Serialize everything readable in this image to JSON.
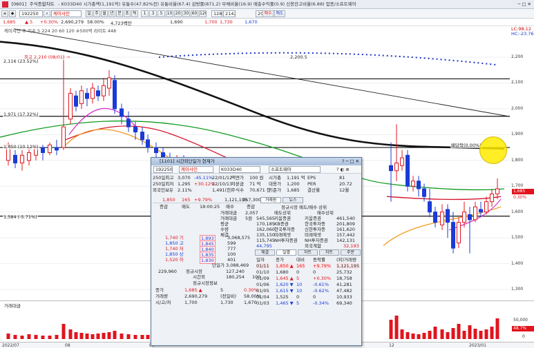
{
  "window_title": {
    "code": "[0601]",
    "name": "주식종합차트",
    "summary": "- K033D40 시가총액(1,191억) 유통수(47.82%전) 유통비율(67.4) 감방률(871.2) 부채비율(16.9) 매출수익률(0.9) 신용잔고비율(6.88) 업종/소프트웨어"
  },
  "toolbar": {
    "code": "192250",
    "name": "케이사인",
    "mode_buttons": [
      "일",
      "주",
      "월",
      "년",
      "분",
      "초",
      "틱"
    ],
    "period_buttons": [
      "1",
      "3",
      "5",
      "10",
      "20",
      "30",
      "60",
      "120"
    ],
    "count": "128",
    "total": "2142",
    "date": "2023/01/11",
    "buy_label": "매수",
    "sell_label": "매도"
  },
  "infobar": {
    "price": "1,685",
    "change": "▲ 5",
    "rate": "+0.30%",
    "volume": "2,690,279",
    "vol_rate": "58.00%",
    "amount": "4,723백만",
    "open": "1,690",
    "high": "1,700",
    "low": "1,730",
    "close": "1,670",
    "text": "1,685 ▲ 5 +0.30% 2,690,279 58.00% 4,723백만 회주전 1,690 1,685 시 1,700 고 1,730 저 1,670"
  },
  "chart": {
    "legend": "케이사인 주 지수 5 224 20 60 120 ※500억 라이트 448",
    "right_top_a": "LC:98.12",
    "right_top_b": "HC:-23.76",
    "high_label": "최고 2,210 (08/01) →",
    "hlines": [
      {
        "label": "2,116 (23.52%)"
      },
      {
        "label": "1,971 (17.32%)"
      },
      {
        "label": "1,850 (10.12%)"
      },
      {
        "label": "1,584 (-5.71%)"
      }
    ],
    "trend_label": "2,200.5",
    "ma_label": "배당락(0.00%)",
    "price_tag": "1,685",
    "price_tag_b": "0.30%",
    "y_ticks": [
      "2,200",
      "2,100",
      "2,000",
      "1,900",
      "1,800",
      "1,700",
      "1,600",
      "1,500",
      "1,400",
      "1,300"
    ],
    "volume_title": "거래대금",
    "volume_ticks": [
      "50,000",
      "0"
    ],
    "volume_tag": "48.7%",
    "x_ticks": [
      "2022/07",
      "08",
      "09",
      "12",
      "2023/01"
    ]
  },
  "popup": {
    "title": "[1101] 시간외단일가 현재가",
    "code": "192250",
    "name": "케이사인",
    "market": "K033D40",
    "sector": "소프트웨어",
    "info_rows": [
      [
        "250일최고",
        "3,070",
        "-45.11%",
        "22/01/12",
        "액면가",
        "100 원",
        "시가총",
        "1,191 억",
        "EPS",
        "81"
      ],
      [
        "250일최저",
        "1,295",
        "+30.12%",
        "22/10/13",
        "자본금",
        "71 억",
        "대용가",
        "1,200",
        "PER",
        "20.72"
      ],
      [
        "외국인보유",
        "2.11%",
        "",
        "1,491(천)",
        "주식수",
        "70,671 천",
        "기준가",
        "1,685",
        "결산월",
        "12월"
      ]
    ],
    "price_row": {
      "price": "1,850",
      "change": "165",
      "rate": "+9.79%",
      "volume": "1,121,195",
      "amount": "357,300"
    },
    "ob_header": [
      "증감",
      "매도",
      "18:00:25",
      "매수",
      "증감"
    ],
    "ob_stats": [
      [
        "거래대금",
        "2,057"
      ],
      [
        "거래대금",
        "5원"
      ],
      [
        "평균",
        ""
      ],
      [
        "수량",
        ""
      ],
      [
        "체결",
        ""
      ]
    ],
    "asks": [
      {
        "price": "1,893",
        "qty": "3,068,575"
      },
      {
        "price": "1,845",
        "qty": "599"
      },
      {
        "price": "1,840",
        "qty": "777"
      },
      {
        "price": "1,835",
        "qty": "100"
      },
      {
        "price": "1,830",
        "qty": "401"
      }
    ],
    "ask_labels": [
      "1,740 기",
      "1,850 고",
      "1,740 저",
      "1,850 상",
      "1,520 하"
    ],
    "single": "단일가",
    "single_val": "3,088,469",
    "vol_a": "229,960",
    "vol_a_lbl": "정규시장",
    "vol_a_val": "127,240",
    "time_lbl": "시간외",
    "time_val": "180,254",
    "time_val2": "100",
    "regular_title": "정규시장정보",
    "regular": [
      [
        "종가",
        "1,685 ▲",
        "5",
        "0.30%"
      ],
      [
        "거래량",
        "2,690,279",
        "(전일비)",
        "58.00%"
      ],
      [
        "시/고/저",
        "1,700",
        "1,730",
        "1,670"
      ]
    ],
    "tabs_top": [
      "거래원",
      "뉴스"
    ],
    "broker_title": "정규시장 매도/매수 상위",
    "broker_head": [
      "매도상위",
      "매수상위"
    ],
    "brokers": [
      [
        "545,565",
        "키움증권",
        "키움증권",
        "461,540"
      ],
      [
        "170,185",
        "KB증권",
        "한국투자증",
        "201,809"
      ],
      [
        "162,060",
        "한국투자증",
        "신한투자증",
        "161,620"
      ],
      [
        "135,150",
        "미래에셋",
        "미래에셋",
        "157,442"
      ],
      [
        "115,745",
        "NH투자증권",
        "NH투자증권",
        "142,131"
      ]
    ],
    "foreign": [
      "44,795",
      "외국계합",
      "32,193"
    ],
    "tabs_mid": [
      "체결",
      "일별",
      "차트",
      "차트",
      "주문"
    ],
    "daily_head": [
      "일자",
      "종가",
      "대비",
      "등락률",
      "(외)거래량"
    ],
    "daily": [
      [
        "01/11",
        "1,850 ▲",
        "165",
        "+9.79%",
        "1,121,195"
      ],
      [
        "01/10",
        "1,680",
        "0",
        "0",
        "25,732"
      ],
      [
        "01/09",
        "1,645 ▲",
        "5",
        "+0.30%",
        "18,758"
      ],
      [
        "01/06",
        "1,620 ▼",
        "10",
        "-0.61%",
        "41,281"
      ],
      [
        "01/05",
        "1,615 ▼",
        "10",
        "-0.62%",
        "47,482"
      ],
      [
        "01/04",
        "1,525",
        "0",
        "0",
        "10,933"
      ],
      [
        "01/03",
        "1,465 ▼",
        "5",
        "-0.34%",
        "69,340"
      ]
    ]
  }
}
